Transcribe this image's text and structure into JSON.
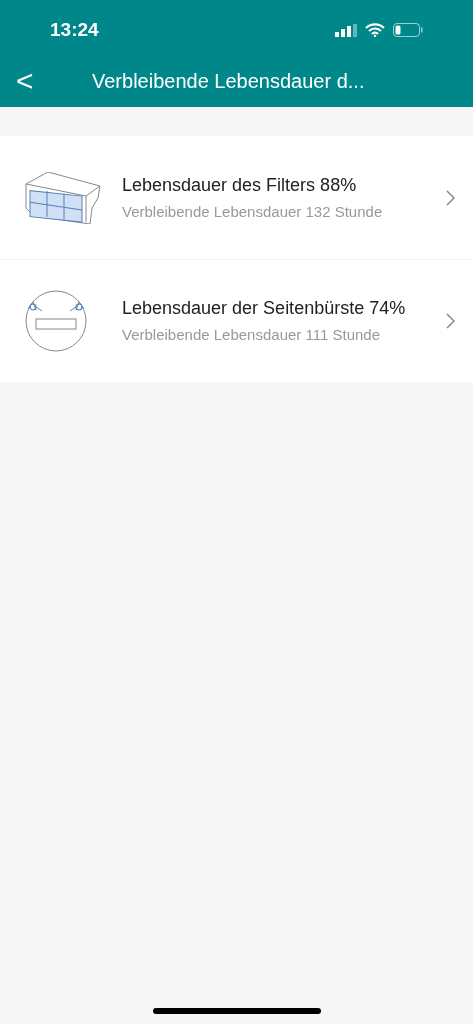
{
  "status_bar": {
    "time": "13:24"
  },
  "header": {
    "back": "<",
    "title": "Verbleibende Lebensdauer d..."
  },
  "items": [
    {
      "kind": "filter",
      "title": "Lebensdauer des Filters 88%",
      "subtitle": "Verbleibende Lebensdauer 132 Stunde"
    },
    {
      "kind": "brush",
      "title": "Lebensdauer der Seitenbürste 74%",
      "subtitle": "Verbleibende Lebensdauer 111 Stunde"
    }
  ]
}
